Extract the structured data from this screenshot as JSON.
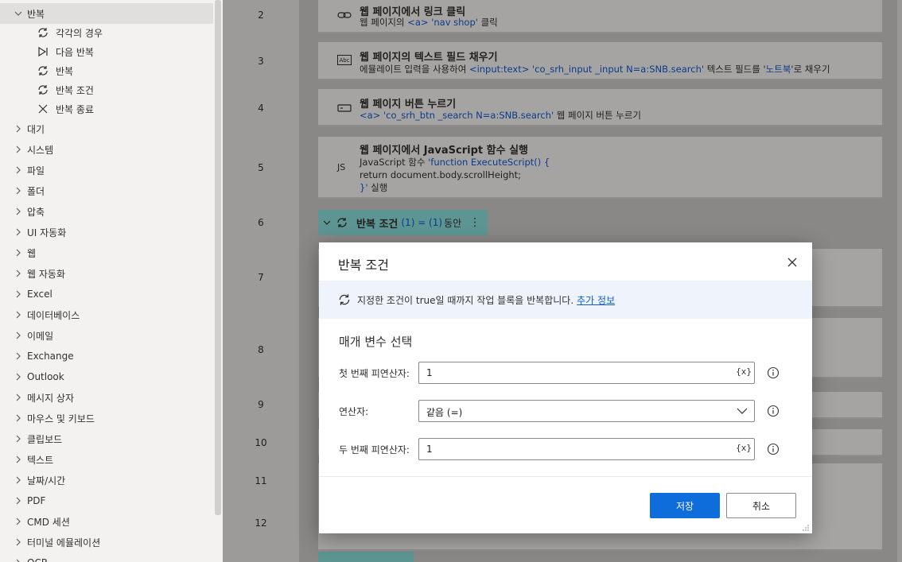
{
  "sidebar": {
    "groups": [
      {
        "label": "반복",
        "expanded": true
      },
      {
        "label": "대기"
      },
      {
        "label": "시스템"
      },
      {
        "label": "파일"
      },
      {
        "label": "폴더"
      },
      {
        "label": "압축"
      },
      {
        "label": "UI 자동화"
      },
      {
        "label": "웹"
      },
      {
        "label": "웹 자동화"
      },
      {
        "label": "Excel"
      },
      {
        "label": "데이터베이스"
      },
      {
        "label": "이메일"
      },
      {
        "label": "Exchange"
      },
      {
        "label": "Outlook"
      },
      {
        "label": "메시지 상자"
      },
      {
        "label": "마우스 및 키보드"
      },
      {
        "label": "클립보드"
      },
      {
        "label": "텍스트"
      },
      {
        "label": "날짜/시간"
      },
      {
        "label": "PDF"
      },
      {
        "label": "CMD 세션"
      },
      {
        "label": "터미널 에뮬레이션"
      },
      {
        "label": "OCR"
      }
    ],
    "loop_items": [
      {
        "label": "각각의 경우",
        "icon": "loop-icon"
      },
      {
        "label": "다음 반복",
        "icon": "next-loop-icon"
      },
      {
        "label": "반복",
        "icon": "loop-icon"
      },
      {
        "label": "반복 조건",
        "icon": "loop-condition-icon"
      },
      {
        "label": "반복 종료",
        "icon": "exit-loop-icon"
      }
    ]
  },
  "flow": {
    "line_numbers": [
      "2",
      "3",
      "4",
      "5",
      "6",
      "7",
      "8",
      "9",
      "10",
      "11",
      "12"
    ],
    "step2": {
      "title": "웹 페이지에서 링크 클릭",
      "d1": "웹 페이지의 ",
      "d2": "<a> 'nav shop'",
      "d3": " 클릭"
    },
    "step3": {
      "icon_text": "Abc",
      "title": "웹 페이지의 텍스트 필드 채우기",
      "d1": "에뮬레이트 입력을 사용하여 ",
      "d2": "<input:text> 'co_srh_input _input N=a:SNB.search'",
      "d3": " 텍스트 필드를 '",
      "d4": "노트북",
      "d5": "'로 채우기"
    },
    "step4": {
      "title": "웹 페이지 버튼 누르기",
      "d1": "<a> 'co_srh_btn _search N=a:SNB.search'",
      "d2": " 웹 페이지 버튼 누르기"
    },
    "step5": {
      "icon_text": "JS",
      "title": "웹 페이지에서 JavaScript 함수 실행",
      "d1": "JavaScript 함수 ",
      "d2": "'function ExecuteScript() {",
      "d3": "return document.body.scrollHeight;",
      "d4": "}'",
      "d5": " 실행"
    },
    "step6": {
      "title": "반복 조건",
      "params": "(1) = (1)",
      "suffix": "동안",
      "more": "⋮"
    }
  },
  "dialog": {
    "title": "반복 조건",
    "info_text": "지정한 조건이 true일 때까지 작업 블록을 반복합니다.",
    "info_link": "추가 정보",
    "section_title": "매개 변수 선택",
    "fields": [
      {
        "label": "첫 번째 피연산자:",
        "value": "1",
        "var_button": "{x}"
      },
      {
        "label": "연산자:",
        "value": "같음 (=)"
      },
      {
        "label": "두 번째 피연산자:",
        "value": "1",
        "var_button": "{x}"
      }
    ],
    "save_label": "저장",
    "cancel_label": "취소",
    "primary_color": "#0f6cdb"
  }
}
